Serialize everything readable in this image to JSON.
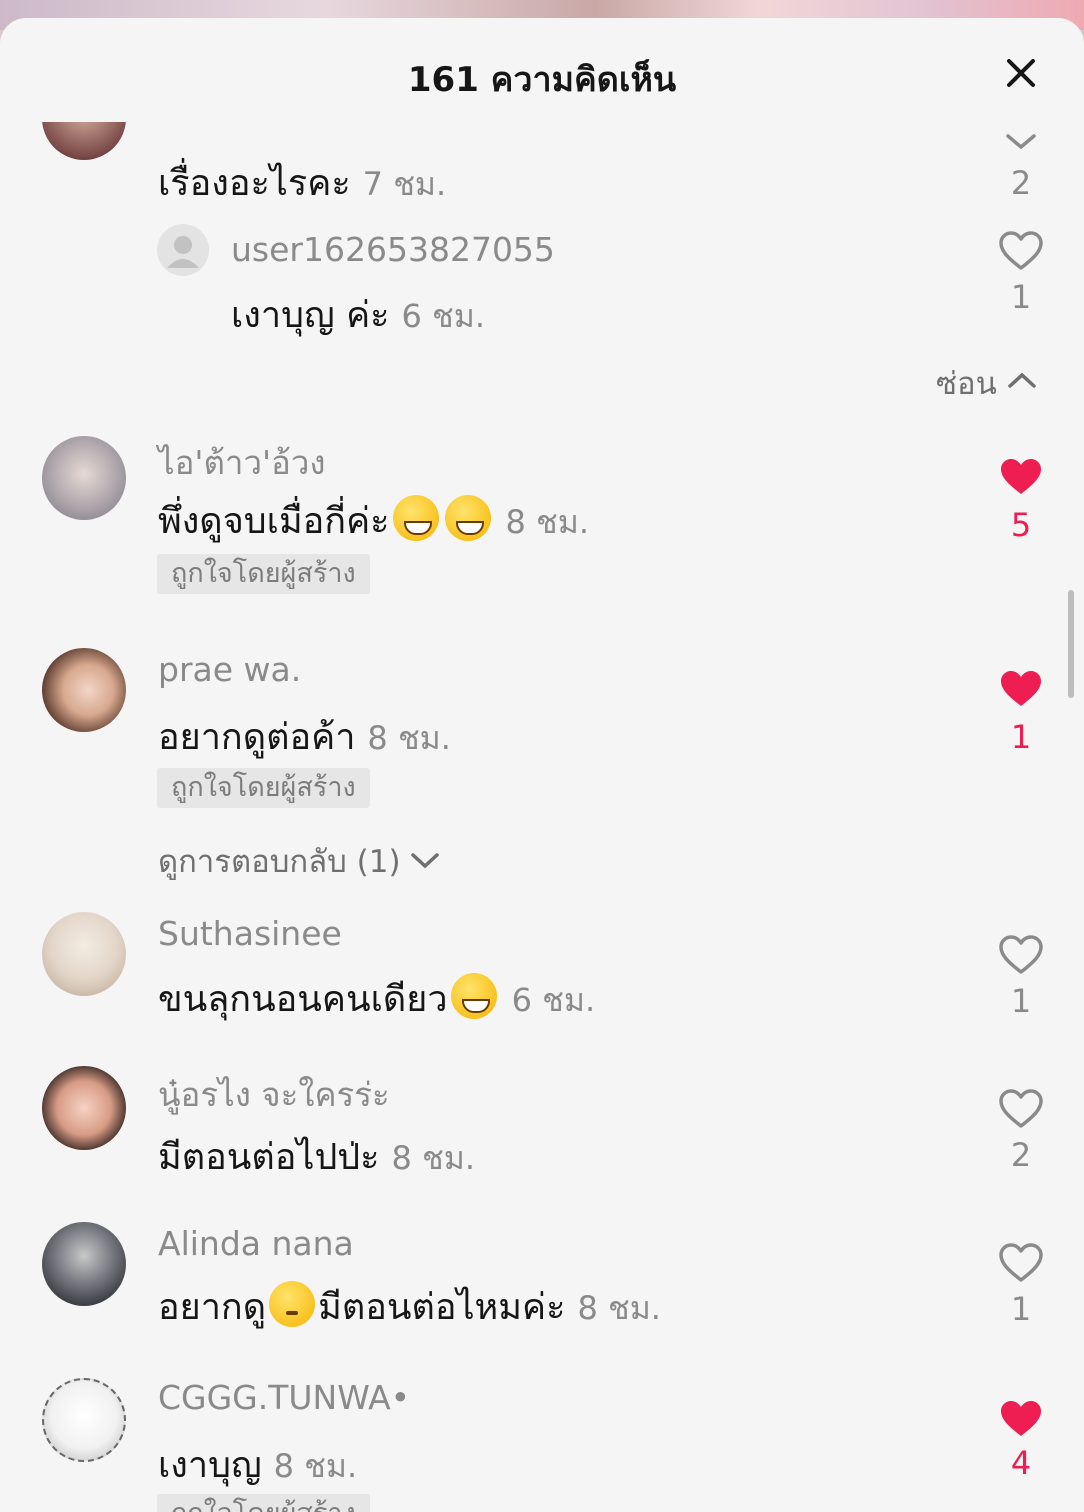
{
  "header": {
    "title": "161 ความคิดเห็น"
  },
  "comments": [
    {
      "text": "เรื่องอะไรคะ",
      "time": "7 ชม.",
      "likes": "2",
      "liked": false,
      "reply": {
        "username": "user162653827055",
        "text": "เงาบุญ ค่ะ",
        "time": "6 ชม.",
        "likes": "1"
      },
      "hide_label": "ซ่อน"
    },
    {
      "username": "ไอ'ต้าว'อ้วง",
      "text": "พึ่งดูจบเมื่อกี่ค่ะ",
      "emoji": [
        "grinning-face-emoji",
        "grinning-face-emoji"
      ],
      "time": "8 ชม.",
      "likes": "5",
      "liked": true,
      "badge": "ถูกใจโดยผู้สร้าง"
    },
    {
      "username": "prae wa.",
      "text": "อยากดูต่อค้า",
      "time": "8 ชม.",
      "likes": "1",
      "liked": true,
      "badge": "ถูกใจโดยผู้สร้าง",
      "view_replies": "ดูการตอบกลับ (1)"
    },
    {
      "username": "Suthasinee",
      "text": "ขนลุกนอนคนเดียว",
      "emoji": [
        "tears-of-joy-emoji"
      ],
      "time": "6 ชม.",
      "likes": "1",
      "liked": false
    },
    {
      "username": "นู๋อรไง จะใครร่ะ",
      "text": "มีตอนต่อไปป่ะ",
      "time": "8 ชม.",
      "likes": "2",
      "liked": false
    },
    {
      "username": "Alinda nana",
      "text_before": "อยากดู",
      "emoji": [
        "flushed-face-emoji"
      ],
      "text": "มีตอนต่อไหมค่ะ",
      "time": "8 ชม.",
      "likes": "1",
      "liked": false
    },
    {
      "username": "CGGG.TUNWA•",
      "text": "เงาบุญ",
      "time": "8 ชม.",
      "likes": "4",
      "liked": true,
      "badge": "ถูกใจโดยผู้สร้าง"
    }
  ],
  "colors": {
    "like_red": "#ee1d52",
    "muted_text": "#8a8a8a",
    "primary_text": "#161616",
    "panel_bg": "#f5f5f5"
  }
}
